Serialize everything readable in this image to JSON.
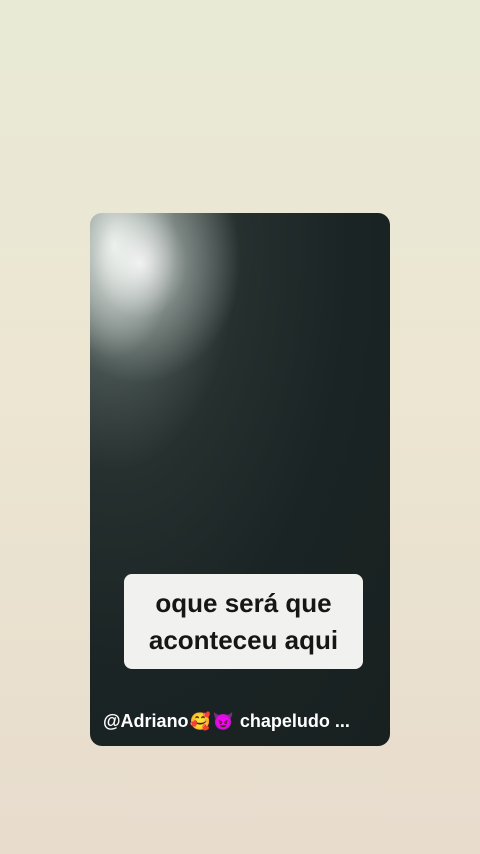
{
  "story": {
    "caption_line1": "oque será que",
    "caption_line2": "aconteceu aqui",
    "username": "@Adriano",
    "emoji_1": "🥰",
    "emoji_2": "😈",
    "footer_text": "chapeludo ..."
  }
}
